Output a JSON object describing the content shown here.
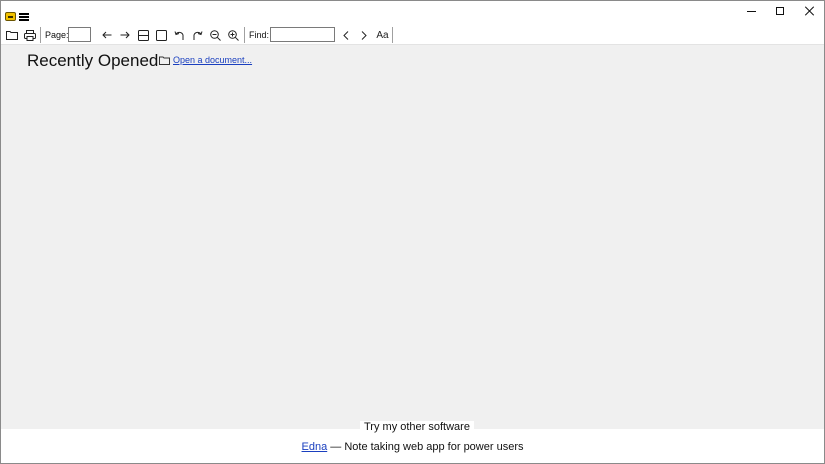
{
  "titlebar": {
    "app_logo_icon": "sumatra-logo-icon",
    "menu_icon": "hamburger-menu-icon",
    "controls": [
      "minimize-icon",
      "maximize-icon",
      "close-icon"
    ]
  },
  "toolbar": {
    "page_label": "Page:",
    "page_value": "",
    "find_label": "Find:",
    "find_value": "",
    "icons": [
      "folder-open-icon",
      "print-icon",
      "arrow-left-icon",
      "arrow-right-icon",
      "fit-page-icon",
      "single-page-icon",
      "rotate-left-icon",
      "rotate-right-icon",
      "zoom-out-icon",
      "zoom-in-icon",
      "find-prev-icon",
      "find-next-icon",
      "match-case-icon"
    ],
    "match_case_glyph": "Aa"
  },
  "main": {
    "recent_title": "Recently Opened",
    "open_document_link": "Open a document..."
  },
  "footer": {
    "try_label": "Try my other software",
    "promo_link": "Edna",
    "promo_text": " — Note taking web app for power users"
  },
  "colors": {
    "content_bg": "#f0f0f0",
    "link": "#1a3fbf",
    "logo": "#f2c200"
  }
}
